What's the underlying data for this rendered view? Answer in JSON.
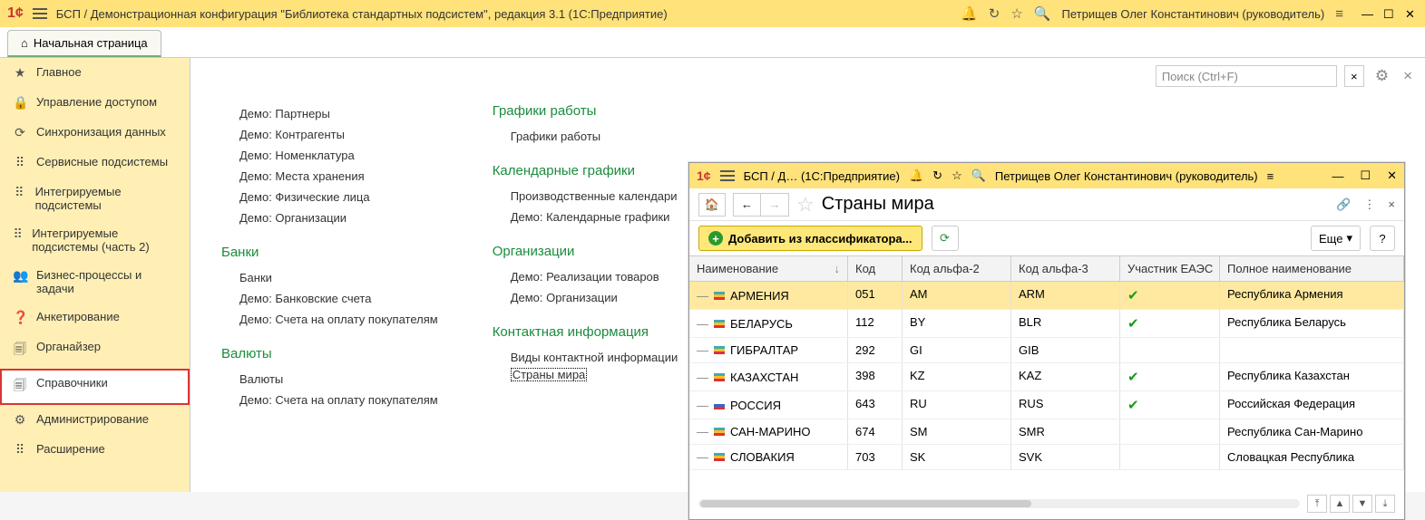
{
  "titlebar": {
    "title": "БСП / Демонстрационная конфигурация \"Библиотека стандартных подсистем\", редакция 3.1  (1С:Предприятие)",
    "user": "Петрищев Олег Константинович (руководитель)"
  },
  "home_tab": "Начальная страница",
  "sidebar": [
    {
      "icon": "★",
      "label": "Главное"
    },
    {
      "icon": "🔒",
      "label": "Управление доступом"
    },
    {
      "icon": "⟳",
      "label": "Синхронизация данных"
    },
    {
      "icon": "⠿",
      "label": "Сервисные подсистемы"
    },
    {
      "icon": "⠿",
      "label": "Интегрируемые подсистемы"
    },
    {
      "icon": "⠿",
      "label": "Интегрируемые подсистемы (часть 2)"
    },
    {
      "icon": "👥",
      "label": "Бизнес-процессы и задачи"
    },
    {
      "icon": "❓",
      "label": "Анкетирование"
    },
    {
      "icon": "🗐",
      "label": "Органайзер"
    },
    {
      "icon": "🗐",
      "label": "Справочники",
      "selected": true
    },
    {
      "icon": "⚙",
      "label": "Администрирование"
    },
    {
      "icon": "⠿",
      "label": "Расширение"
    }
  ],
  "search_placeholder": "Поиск (Ctrl+F)",
  "col1": {
    "items": [
      "Демо: Партнеры",
      "Демо: Контрагенты",
      "Демо: Номенклатура",
      "Демо: Места хранения",
      "Демо: Физические лица",
      "Демо: Организации"
    ],
    "h2": "Банки",
    "items2": [
      "Банки",
      "Демо: Банковские счета",
      "Демо: Счета на оплату покупателям"
    ],
    "h3": "Валюты",
    "items3": [
      "Валюты",
      "Демо: Счета на оплату покупателям"
    ]
  },
  "col2": {
    "h1": "Графики работы",
    "i1": [
      "Графики работы"
    ],
    "h2": "Календарные графики",
    "i2": [
      "Производственные календари",
      "Демо: Календарные графики"
    ],
    "h3": "Организации",
    "i3": [
      "Демо: Реализации товаров",
      "Демо: Организации"
    ],
    "h4": "Контактная информация",
    "i4": [
      "Виды контактной информации",
      "Страны мира"
    ]
  },
  "subwin": {
    "bar_title": "БСП / Д…  (1С:Предприятие)",
    "user": "Петрищев Олег Константинович (руководитель)",
    "title": "Страны мира",
    "add_label": "Добавить из классификатора...",
    "more": "Еще",
    "headers": [
      "Наименование",
      "Код",
      "Код альфа-2",
      "Код альфа-3",
      "Участник ЕАЭС",
      "Полное наименование"
    ],
    "rows": [
      {
        "name": "АРМЕНИЯ",
        "code": "051",
        "a2": "AM",
        "a3": "ARM",
        "eaes": true,
        "full": "Республика Армения",
        "sel": true,
        "flagclass": ""
      },
      {
        "name": "БЕЛАРУСЬ",
        "code": "112",
        "a2": "BY",
        "a3": "BLR",
        "eaes": true,
        "full": "Республика Беларусь",
        "flagclass": ""
      },
      {
        "name": "ГИБРАЛТАР",
        "code": "292",
        "a2": "GI",
        "a3": "GIB",
        "eaes": false,
        "full": "",
        "flagclass": ""
      },
      {
        "name": "КАЗАХСТАН",
        "code": "398",
        "a2": "KZ",
        "a3": "KAZ",
        "eaes": true,
        "full": "Республика Казахстан",
        "flagclass": ""
      },
      {
        "name": "РОССИЯ",
        "code": "643",
        "a2": "RU",
        "a3": "RUS",
        "eaes": true,
        "full": "Российская Федерация",
        "flagclass": "ru"
      },
      {
        "name": "САН-МАРИНО",
        "code": "674",
        "a2": "SM",
        "a3": "SMR",
        "eaes": false,
        "full": "Республика Сан-Марино",
        "flagclass": ""
      },
      {
        "name": "СЛОВАКИЯ",
        "code": "703",
        "a2": "SK",
        "a3": "SVK",
        "eaes": false,
        "full": "Словацкая Республика",
        "flagclass": ""
      }
    ]
  }
}
